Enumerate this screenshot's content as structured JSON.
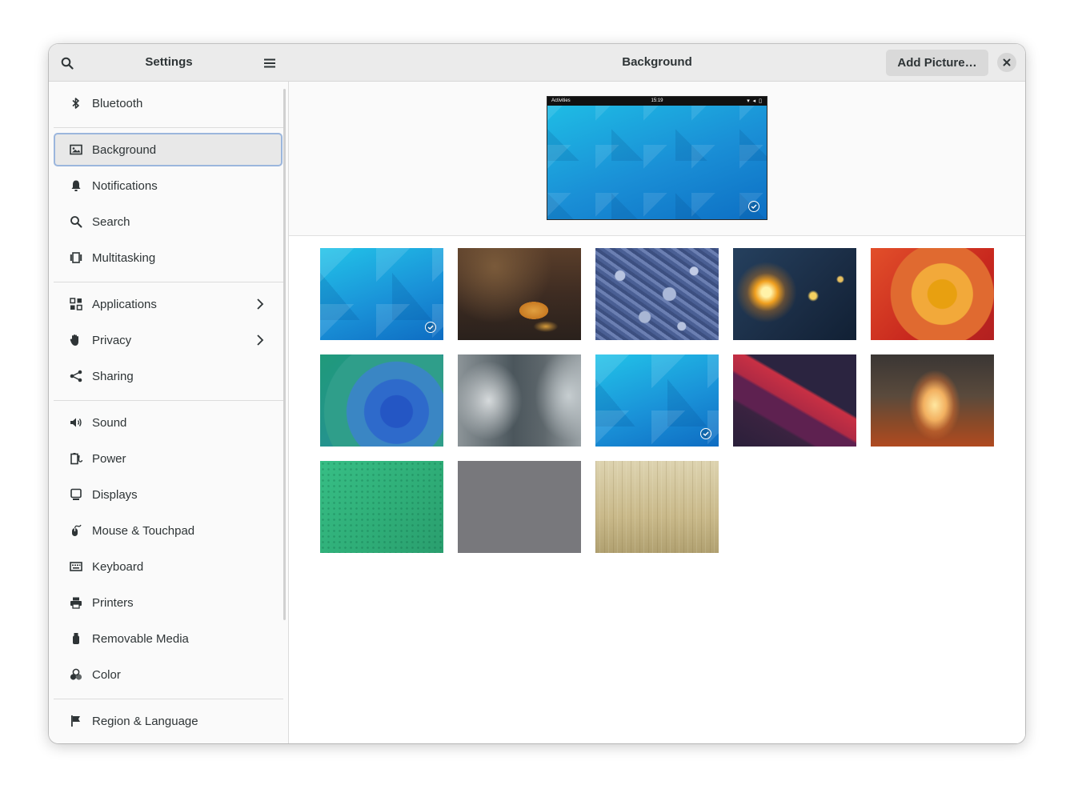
{
  "sidebar": {
    "title": "Settings",
    "items": [
      {
        "label": "Bluetooth",
        "icon": "bluetooth-icon"
      },
      {
        "label": "Background",
        "icon": "background-icon",
        "selected": true
      },
      {
        "label": "Notifications",
        "icon": "bell-icon"
      },
      {
        "label": "Search",
        "icon": "search-icon"
      },
      {
        "label": "Multitasking",
        "icon": "multitasking-icon"
      },
      {
        "label": "Applications",
        "icon": "applications-icon",
        "has_submenu": true
      },
      {
        "label": "Privacy",
        "icon": "hand-icon",
        "has_submenu": true
      },
      {
        "label": "Sharing",
        "icon": "share-icon"
      },
      {
        "label": "Sound",
        "icon": "speaker-icon"
      },
      {
        "label": "Power",
        "icon": "power-icon"
      },
      {
        "label": "Displays",
        "icon": "display-icon"
      },
      {
        "label": "Mouse & Touchpad",
        "icon": "mouse-icon"
      },
      {
        "label": "Keyboard",
        "icon": "keyboard-icon"
      },
      {
        "label": "Printers",
        "icon": "printer-icon"
      },
      {
        "label": "Removable Media",
        "icon": "usb-icon"
      },
      {
        "label": "Color",
        "icon": "color-icon"
      },
      {
        "label": "Region & Language",
        "icon": "flag-icon"
      }
    ]
  },
  "main": {
    "title": "Background",
    "add_button": "Add Picture…",
    "preview": {
      "topbar_left": "Activities",
      "topbar_clock": "15:19",
      "topbar_status": "▾ ◂ ▯"
    },
    "wallpapers": [
      {
        "name": "adwaita-blue-day",
        "selected": true
      },
      {
        "name": "autumn-leaf",
        "selected": false
      },
      {
        "name": "snowy-forest-aerial",
        "selected": false
      },
      {
        "name": "light-bulb",
        "selected": false
      },
      {
        "name": "hexagon-orange",
        "selected": false
      },
      {
        "name": "triangles-teal",
        "selected": false
      },
      {
        "name": "blurred-gray",
        "selected": false
      },
      {
        "name": "adwaita-blue-night",
        "selected": true
      },
      {
        "name": "purple-waves",
        "selected": false
      },
      {
        "name": "misty-forest-path",
        "selected": false
      },
      {
        "name": "green-dots",
        "selected": false
      },
      {
        "name": "plain-gray",
        "selected": false
      },
      {
        "name": "wood-texture",
        "selected": false
      }
    ]
  },
  "colors": {
    "header_bg": "#ebebeb",
    "selection_border": "#9bb6dd",
    "selection_bg": "#e8e8e8"
  }
}
